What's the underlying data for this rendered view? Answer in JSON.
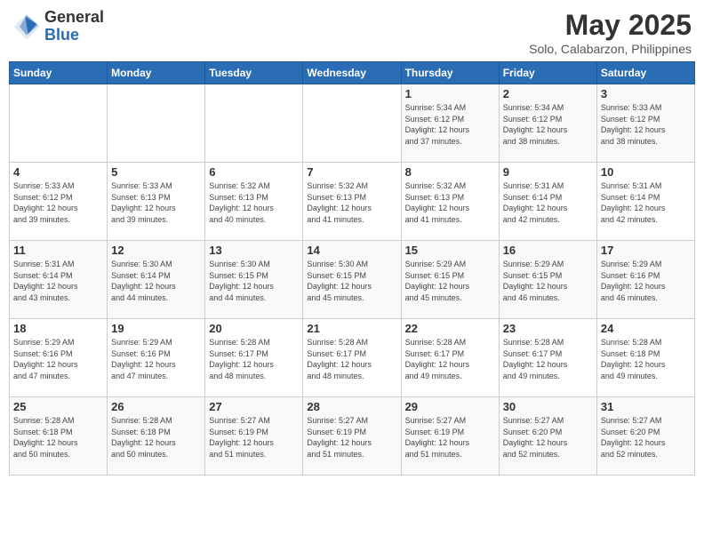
{
  "header": {
    "logo_general": "General",
    "logo_blue": "Blue",
    "month_title": "May 2025",
    "location": "Solo, Calabarzon, Philippines"
  },
  "weekdays": [
    "Sunday",
    "Monday",
    "Tuesday",
    "Wednesday",
    "Thursday",
    "Friday",
    "Saturday"
  ],
  "weeks": [
    [
      {
        "day": "",
        "info": ""
      },
      {
        "day": "",
        "info": ""
      },
      {
        "day": "",
        "info": ""
      },
      {
        "day": "",
        "info": ""
      },
      {
        "day": "1",
        "info": "Sunrise: 5:34 AM\nSunset: 6:12 PM\nDaylight: 12 hours\nand 37 minutes."
      },
      {
        "day": "2",
        "info": "Sunrise: 5:34 AM\nSunset: 6:12 PM\nDaylight: 12 hours\nand 38 minutes."
      },
      {
        "day": "3",
        "info": "Sunrise: 5:33 AM\nSunset: 6:12 PM\nDaylight: 12 hours\nand 38 minutes."
      }
    ],
    [
      {
        "day": "4",
        "info": "Sunrise: 5:33 AM\nSunset: 6:12 PM\nDaylight: 12 hours\nand 39 minutes."
      },
      {
        "day": "5",
        "info": "Sunrise: 5:33 AM\nSunset: 6:13 PM\nDaylight: 12 hours\nand 39 minutes."
      },
      {
        "day": "6",
        "info": "Sunrise: 5:32 AM\nSunset: 6:13 PM\nDaylight: 12 hours\nand 40 minutes."
      },
      {
        "day": "7",
        "info": "Sunrise: 5:32 AM\nSunset: 6:13 PM\nDaylight: 12 hours\nand 41 minutes."
      },
      {
        "day": "8",
        "info": "Sunrise: 5:32 AM\nSunset: 6:13 PM\nDaylight: 12 hours\nand 41 minutes."
      },
      {
        "day": "9",
        "info": "Sunrise: 5:31 AM\nSunset: 6:14 PM\nDaylight: 12 hours\nand 42 minutes."
      },
      {
        "day": "10",
        "info": "Sunrise: 5:31 AM\nSunset: 6:14 PM\nDaylight: 12 hours\nand 42 minutes."
      }
    ],
    [
      {
        "day": "11",
        "info": "Sunrise: 5:31 AM\nSunset: 6:14 PM\nDaylight: 12 hours\nand 43 minutes."
      },
      {
        "day": "12",
        "info": "Sunrise: 5:30 AM\nSunset: 6:14 PM\nDaylight: 12 hours\nand 44 minutes."
      },
      {
        "day": "13",
        "info": "Sunrise: 5:30 AM\nSunset: 6:15 PM\nDaylight: 12 hours\nand 44 minutes."
      },
      {
        "day": "14",
        "info": "Sunrise: 5:30 AM\nSunset: 6:15 PM\nDaylight: 12 hours\nand 45 minutes."
      },
      {
        "day": "15",
        "info": "Sunrise: 5:29 AM\nSunset: 6:15 PM\nDaylight: 12 hours\nand 45 minutes."
      },
      {
        "day": "16",
        "info": "Sunrise: 5:29 AM\nSunset: 6:15 PM\nDaylight: 12 hours\nand 46 minutes."
      },
      {
        "day": "17",
        "info": "Sunrise: 5:29 AM\nSunset: 6:16 PM\nDaylight: 12 hours\nand 46 minutes."
      }
    ],
    [
      {
        "day": "18",
        "info": "Sunrise: 5:29 AM\nSunset: 6:16 PM\nDaylight: 12 hours\nand 47 minutes."
      },
      {
        "day": "19",
        "info": "Sunrise: 5:29 AM\nSunset: 6:16 PM\nDaylight: 12 hours\nand 47 minutes."
      },
      {
        "day": "20",
        "info": "Sunrise: 5:28 AM\nSunset: 6:17 PM\nDaylight: 12 hours\nand 48 minutes."
      },
      {
        "day": "21",
        "info": "Sunrise: 5:28 AM\nSunset: 6:17 PM\nDaylight: 12 hours\nand 48 minutes."
      },
      {
        "day": "22",
        "info": "Sunrise: 5:28 AM\nSunset: 6:17 PM\nDaylight: 12 hours\nand 49 minutes."
      },
      {
        "day": "23",
        "info": "Sunrise: 5:28 AM\nSunset: 6:17 PM\nDaylight: 12 hours\nand 49 minutes."
      },
      {
        "day": "24",
        "info": "Sunrise: 5:28 AM\nSunset: 6:18 PM\nDaylight: 12 hours\nand 49 minutes."
      }
    ],
    [
      {
        "day": "25",
        "info": "Sunrise: 5:28 AM\nSunset: 6:18 PM\nDaylight: 12 hours\nand 50 minutes."
      },
      {
        "day": "26",
        "info": "Sunrise: 5:28 AM\nSunset: 6:18 PM\nDaylight: 12 hours\nand 50 minutes."
      },
      {
        "day": "27",
        "info": "Sunrise: 5:27 AM\nSunset: 6:19 PM\nDaylight: 12 hours\nand 51 minutes."
      },
      {
        "day": "28",
        "info": "Sunrise: 5:27 AM\nSunset: 6:19 PM\nDaylight: 12 hours\nand 51 minutes."
      },
      {
        "day": "29",
        "info": "Sunrise: 5:27 AM\nSunset: 6:19 PM\nDaylight: 12 hours\nand 51 minutes."
      },
      {
        "day": "30",
        "info": "Sunrise: 5:27 AM\nSunset: 6:20 PM\nDaylight: 12 hours\nand 52 minutes."
      },
      {
        "day": "31",
        "info": "Sunrise: 5:27 AM\nSunset: 6:20 PM\nDaylight: 12 hours\nand 52 minutes."
      }
    ]
  ]
}
